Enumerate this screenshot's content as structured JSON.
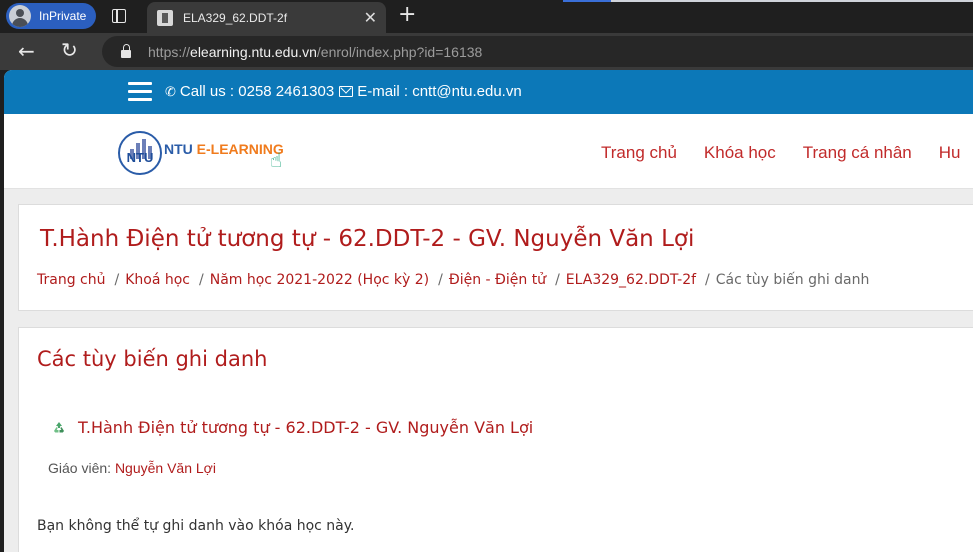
{
  "browser": {
    "profile_label": "InPrivate",
    "tab_title": "ELA329_62.DDT-2f",
    "url_scheme": "https://",
    "url_host": "elearning.ntu.edu.vn",
    "url_path": "/enrol/index.php?id=16138",
    "tab_close_glyph": "✕",
    "new_tab_glyph": "+"
  },
  "topbar": {
    "phone_text": "Call us : 0258 2461303",
    "email_text": "E-mail : cntt@ntu.edu.vn",
    "color": "#0c78b8"
  },
  "logo": {
    "badge_text": "NTU",
    "text_prefix": "NTU ",
    "text_suffix": "E-LEARNING"
  },
  "nav": {
    "items": [
      "Trang chủ",
      "Khóa học",
      "Trang cá nhân",
      "Hu"
    ]
  },
  "course": {
    "title": "T.Hành Điện tử tương tự - 62.DDT-2 - GV. Nguyễn Văn Lợi"
  },
  "breadcrumb": {
    "items": [
      "Trang chủ",
      "Khoá học",
      "Năm học 2021-2022 (Học kỳ 2)",
      "Điện - Điện tử",
      "ELA329_62.DDT-2f"
    ],
    "current": "Các tùy biến ghi danh",
    "separator": "/"
  },
  "enrol": {
    "heading": "Các tùy biến ghi danh",
    "course_link": "T.Hành Điện tử tương tự - 62.DDT-2 - GV. Nguyễn Văn Lợi",
    "teacher_label": "Giáo viên:",
    "teacher_name": "Nguyễn Văn Lợi",
    "notice": "Bạn không thể tự ghi danh vào khóa học này."
  },
  "colors": {
    "accent_red": "#b01c1c",
    "logo_blue": "#2a5ca8",
    "logo_orange": "#f07b1d"
  }
}
